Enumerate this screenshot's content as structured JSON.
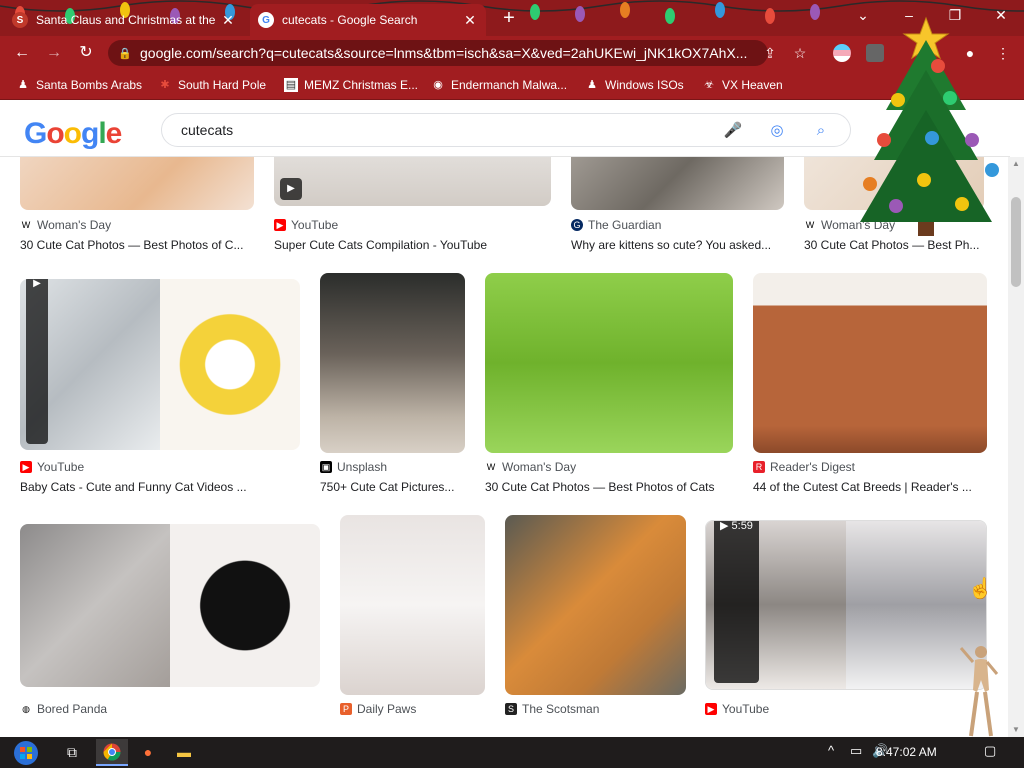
{
  "browser": {
    "tabs": [
      {
        "title": "Santa Claus and Christmas at the",
        "active": false
      },
      {
        "title": "cutecats - Google Search",
        "active": true
      }
    ],
    "new_tab_glyph": "+",
    "window_controls": {
      "list": "⌄",
      "minimize": "–",
      "maximize": "❐",
      "close": "✕"
    },
    "url": "google.com/search?q=cutecats&source=lnms&tbm=isch&sa=X&ved=2ahUKEwi_jNK1kOX7AhX...",
    "bookmarks": [
      {
        "label": "Santa Bombs Arabs",
        "icon": "figure-icon"
      },
      {
        "label": "South Hard Pole",
        "icon": "snowflake-icon"
      },
      {
        "label": "MEMZ Christmas E...",
        "icon": "page-icon"
      },
      {
        "label": "Endermanch Malwa...",
        "icon": "raccoon-icon"
      },
      {
        "label": "Windows ISOs",
        "icon": "figure-icon"
      },
      {
        "label": "VX Heaven",
        "icon": "biohazard-icon"
      }
    ]
  },
  "google": {
    "logo_letters": [
      "G",
      "o",
      "o",
      "g",
      "l",
      "e"
    ],
    "search_query": "cutecats"
  },
  "results": {
    "row1": [
      {
        "source": "Woman's Day",
        "caption": "30 Cute Cat Photos — Best Photos of C..."
      },
      {
        "source": "YouTube",
        "caption": "Super Cute Cats Compilation - YouTube"
      },
      {
        "source": "The Guardian",
        "caption": "Why are kittens so cute? You asked..."
      },
      {
        "source": "Woman's Day",
        "caption": "30 Cute Cat Photos — Best Ph..."
      }
    ],
    "row2": [
      {
        "source": "YouTube",
        "caption": "Baby Cats - Cute and Funny Cat Videos ..."
      },
      {
        "source": "Unsplash",
        "caption": "750+ Cute Cat Pictures..."
      },
      {
        "source": "Woman's Day",
        "caption": "30 Cute Cat Photos — Best Photos of Cats"
      },
      {
        "source": "Reader's Digest",
        "caption": "44 of the Cutest Cat Breeds | Reader's ..."
      }
    ],
    "row3": [
      {
        "source": "Bored Panda"
      },
      {
        "source": "Daily Paws"
      },
      {
        "source": "The Scotsman"
      },
      {
        "source": "YouTube",
        "duration": "5:59"
      }
    ]
  },
  "taskbar": {
    "clock": "8:47:02 AM"
  },
  "colors": {
    "frame_red": "#a11d20",
    "tabstrip_red": "#8e1a1c",
    "google_blue": "#4285f4",
    "google_red": "#ea4335",
    "google_yellow": "#fbbc05",
    "google_green": "#34a853"
  }
}
